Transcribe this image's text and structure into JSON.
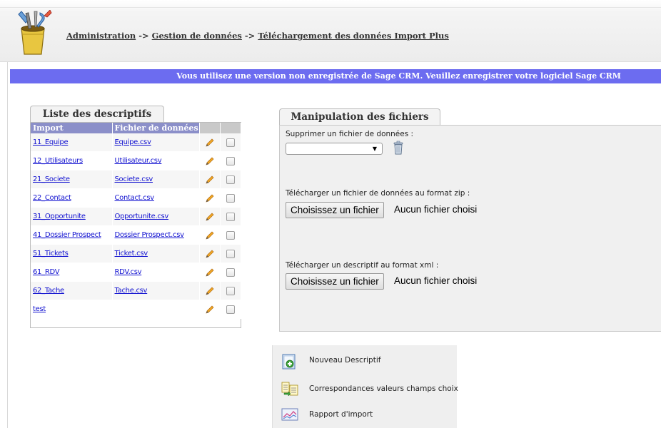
{
  "breadcrumb": {
    "items": [
      "Administration",
      "Gestion de données",
      "Téléchargement des données Import Plus"
    ],
    "separator": "->"
  },
  "banner": {
    "text": "Vous utilisez une version non enregistrée de Sage CRM. Veuillez enregistrer votre logiciel Sage CRM"
  },
  "descriptifs": {
    "tab_label": "Liste des descriptifs",
    "columns": [
      "Import",
      "Fichier de données"
    ],
    "rows": [
      {
        "import": "11_Equipe",
        "file": "Equipe.csv"
      },
      {
        "import": "12_Utilisateurs",
        "file": "Utilisateur.csv"
      },
      {
        "import": "21_Societe",
        "file": "Societe.csv"
      },
      {
        "import": "22_Contact",
        "file": "Contact.csv"
      },
      {
        "import": "31_Opportunite",
        "file": "Opportunite.csv"
      },
      {
        "import": "41_Dossier Prospect",
        "file": "Dossier Prospect.csv"
      },
      {
        "import": "51_Tickets",
        "file": "Ticket.csv"
      },
      {
        "import": "61_RDV",
        "file": "RDV.csv"
      },
      {
        "import": "62_Tache",
        "file": "Tache.csv"
      },
      {
        "import": "test",
        "file": ""
      }
    ]
  },
  "manipulation": {
    "tab_label": "Manipulation des fichiers",
    "delete_label": "Supprimer un fichier de données :",
    "delete_select_value": "",
    "zip_label": "Télécharger un fichier de données au format zip :",
    "xml_label": "Télécharger un descriptif au format xml :",
    "choose_button": "Choisissez un fichier",
    "no_file": "Aucun fichier choisi"
  },
  "actions": [
    {
      "label": "Nouveau Descriptif",
      "icon": "new-document-icon"
    },
    {
      "label": "Correspondances valeurs champs choix",
      "icon": "mapping-icon"
    },
    {
      "label": "Rapport d'import",
      "icon": "report-chart-icon"
    }
  ],
  "colors": {
    "banner": "#6c6cf0",
    "table_header": "#8b8fc9",
    "link": "#1010d0"
  }
}
